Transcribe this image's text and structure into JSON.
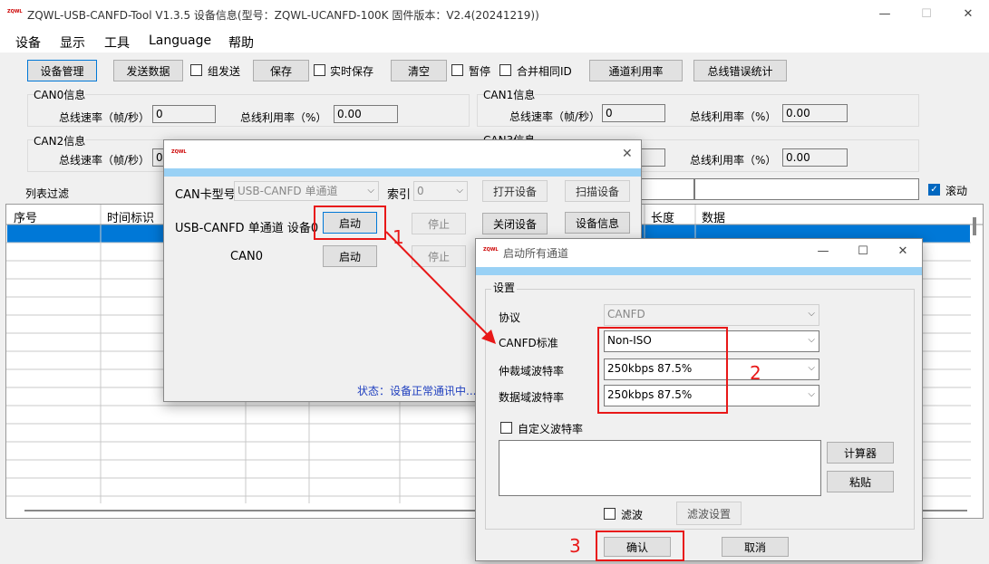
{
  "app": {
    "title": "ZQWL-USB-CANFD-Tool    V1.3.5    设备信息(型号：ZQWL-UCANFD-100K   固件版本：V2.4(20241219))",
    "logo": "ZQWL"
  },
  "menu": [
    "设备",
    "显示",
    "工具",
    "Language",
    "帮助"
  ],
  "toolbar": {
    "device_mgmt": "设备管理",
    "send_data": "发送数据",
    "group_send": "组发送",
    "save": "保存",
    "realtime_save": "实时保存",
    "clear": "清空",
    "pause": "暂停",
    "merge_same_id": "合并相同ID",
    "channel_util": "通道利用率",
    "bus_error_stats": "总线错误统计"
  },
  "can_info": [
    {
      "title": "CAN0信息",
      "rate_label": "总线速率（帧/秒）",
      "rate": "0",
      "util_label": "总线利用率（%）",
      "util": "0.00"
    },
    {
      "title": "CAN1信息",
      "rate_label": "总线速率（帧/秒）",
      "rate": "0",
      "util_label": "总线利用率（%）",
      "util": "0.00"
    },
    {
      "title": "CAN2信息",
      "rate_label": "总线速率（帧/秒）",
      "rate": "0",
      "util_label": "总线利用率（%）",
      "util": "0.00"
    },
    {
      "title": "CAN3信息",
      "rate_label": "总线速率（帧/秒）",
      "rate": "0",
      "util_label": "总线利用率（%）",
      "util": "0.00"
    }
  ],
  "list": {
    "filter_label": "列表过滤",
    "scroll_label": "滚动",
    "columns": [
      "序号",
      "时间标识",
      "长度",
      "数据"
    ]
  },
  "device_dialog": {
    "card_type_label": "CAN卡型号",
    "card_type": "USB-CANFD 单通道",
    "index_label": "索引",
    "index": "0",
    "open_device": "打开设备",
    "scan_device": "扫描设备",
    "device_row_label": "USB-CANFD 单通道  设备0",
    "start": "启动",
    "stop": "停止",
    "close_device": "关闭设备",
    "device_info": "设备信息",
    "can0_label": "CAN0",
    "can0_start": "启动",
    "can0_stop": "停止",
    "status": "状态：设备正常通讯中..."
  },
  "start_dialog": {
    "title": "启动所有通道",
    "settings_label": "设置",
    "protocol_label": "协议",
    "protocol": "CANFD",
    "canfd_std_label": "CANFD标准",
    "canfd_std": "Non-ISO",
    "arb_label": "仲裁域波特率",
    "arb_baud": "250kbps 87.5%",
    "data_label": "数据域波特率",
    "data_baud": "250kbps 87.5%",
    "custom_baud_label": "自定义波特率",
    "calculator": "计算器",
    "paste": "粘贴",
    "filter_label": "滤波",
    "filter_settings": "滤波设置",
    "confirm": "确认",
    "cancel": "取消"
  },
  "annotations": [
    "1",
    "2",
    "3"
  ],
  "colors": {
    "accent": "#0078d7",
    "selected_row": "#0078d7",
    "annotation": "#e81818"
  }
}
